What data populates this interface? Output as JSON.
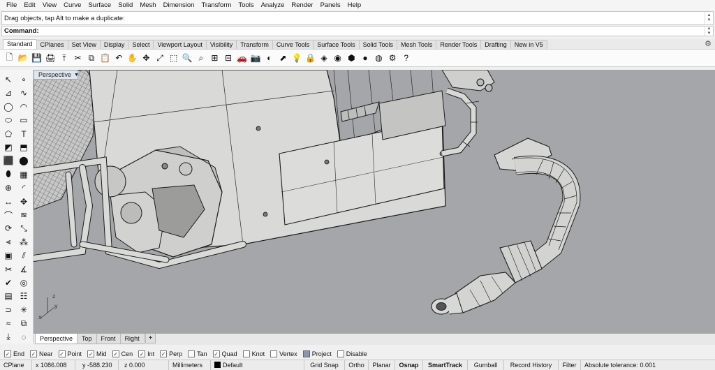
{
  "menubar": [
    "File",
    "Edit",
    "View",
    "Curve",
    "Surface",
    "Solid",
    "Mesh",
    "Dimension",
    "Transform",
    "Tools",
    "Analyze",
    "Render",
    "Panels",
    "Help"
  ],
  "command": {
    "history": "Drag objects, tap Alt to make a duplicate:",
    "prompt": "Command:"
  },
  "tabs": [
    "Standard",
    "CPlanes",
    "Set View",
    "Display",
    "Select",
    "Viewport Layout",
    "Visibility",
    "Transform",
    "Curve Tools",
    "Surface Tools",
    "Solid Tools",
    "Mesh Tools",
    "Render Tools",
    "Drafting",
    "New in V5"
  ],
  "active_tab": "Standard",
  "toolbar_icons": [
    "new-file-icon",
    "open-file-icon",
    "save-icon",
    "print-icon",
    "import-icon",
    "cut-icon",
    "copy-icon",
    "paste-icon",
    "undo-icon",
    "pan-hand-icon",
    "rotate-view-icon",
    "zoom-extents-icon",
    "zoom-window-icon",
    "zoom-dynamic-icon",
    "zoom-selected-icon",
    "four-view-icon",
    "grid-view-icon",
    "car-icon",
    "camera-icon",
    "named-view-icon",
    "select-icon",
    "lightbulb-icon",
    "lock-icon",
    "layer-icon",
    "color-wheel-icon",
    "material-icon",
    "render-sphere-icon",
    "render-preview-icon",
    "options-gear-icon",
    "help-icon"
  ],
  "toolbar_glyphs": [
    "🗋",
    "📂",
    "💾",
    "🖨",
    "⤒",
    "✂",
    "⧉",
    "📋",
    "↶",
    "✋",
    "✥",
    "⤢",
    "⬚",
    "🔍",
    "⌕",
    "⊞",
    "⊟",
    "🚗",
    "📷",
    "◐",
    "⬈",
    "💡",
    "🔒",
    "◈",
    "◉",
    "⬢",
    "●",
    "◍",
    "⚙",
    "?"
  ],
  "left_tools": [
    "select-arrow-icon",
    "point-icon",
    "polyline-icon",
    "curve-icon",
    "circle-icon",
    "arc-icon",
    "ellipse-icon",
    "rectangle-icon",
    "polygon-icon",
    "text-icon",
    "surface-icon",
    "extrude-icon",
    "box-solid-icon",
    "sphere-solid-icon",
    "cylinder-icon",
    "mesh-icon",
    "boolean-icon",
    "fillet-icon",
    "dimension-icon",
    "move-icon",
    "sweep-icon",
    "loft-icon",
    "rotate-icon",
    "scale-icon",
    "align-icon",
    "array-icon",
    "group-icon",
    "split-icon",
    "trim-icon",
    "analyze-icon",
    "check-icon",
    "render-icon",
    "layer-tool-icon",
    "properties-icon",
    "join-icon",
    "explode-icon",
    "blend-icon",
    "offset-icon",
    "project-icon",
    "hide-icon"
  ],
  "left_glyphs": [
    "↖",
    "∘",
    "⊿",
    "∿",
    "◯",
    "◠",
    "⬭",
    "▭",
    "⬠",
    "T",
    "◩",
    "⬒",
    "⬛",
    "⬤",
    "⬮",
    "▦",
    "⊕",
    "◜",
    "↔",
    "✥",
    "⌒",
    "≋",
    "⟳",
    "⤡",
    "⫷",
    "⁂",
    "▣",
    "⫽",
    "✂",
    "∡",
    "✔",
    "◎",
    "▤",
    "☷",
    "⊃",
    "✳",
    "≈",
    "⧉",
    "⤓",
    "◌"
  ],
  "viewport": {
    "title": "Perspective",
    "axes": {
      "x": "x",
      "y": "y",
      "z": "z"
    }
  },
  "viewport_tabs": [
    "Perspective",
    "Top",
    "Front",
    "Right"
  ],
  "viewport_tab_add": "+",
  "osnaps": [
    {
      "label": "End",
      "checked": true
    },
    {
      "label": "Near",
      "checked": true
    },
    {
      "label": "Point",
      "checked": true
    },
    {
      "label": "Mid",
      "checked": true
    },
    {
      "label": "Cen",
      "checked": true
    },
    {
      "label": "Int",
      "checked": true
    },
    {
      "label": "Perp",
      "checked": true
    },
    {
      "label": "Tan",
      "checked": false
    },
    {
      "label": "Quad",
      "checked": true
    },
    {
      "label": "Knot",
      "checked": false
    },
    {
      "label": "Vertex",
      "checked": false
    },
    {
      "label": "Project",
      "checked": "filled"
    },
    {
      "label": "Disable",
      "checked": false
    }
  ],
  "statusbar": {
    "cplane": "CPlane",
    "x": "x 1086.008",
    "y": "y -588.230",
    "z": "z 0.000",
    "units": "Millimeters",
    "layer": "Default",
    "grid_snap": "Grid Snap",
    "ortho": "Ortho",
    "planar": "Planar",
    "osnap": "Osnap",
    "smarttrack": "SmartTrack",
    "gumball": "Gumball",
    "record_history": "Record History",
    "filter": "Filter",
    "tolerance": "Absolute tolerance: 0.001"
  },
  "colors": {
    "viewport_bg": "#a4a6a9",
    "model_fill": "#d9d9d7",
    "wire": "#1c1c1c"
  }
}
